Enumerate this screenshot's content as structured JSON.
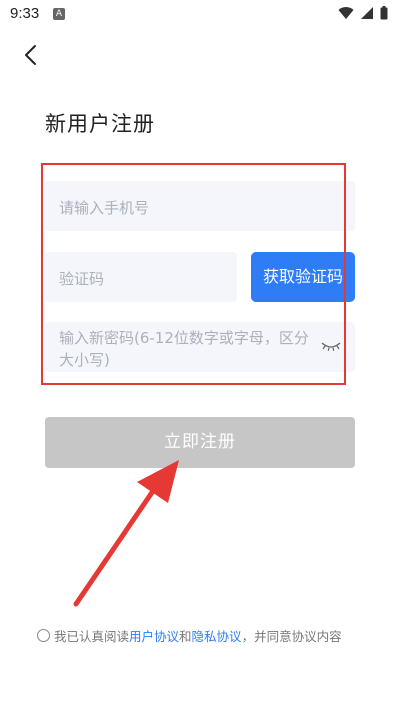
{
  "status_bar": {
    "time": "9:33",
    "notification_letter": "A"
  },
  "header": {
    "title": "新用户注册"
  },
  "form": {
    "phone_placeholder": "请输入手机号",
    "code_placeholder": "验证码",
    "get_code_label": "获取验证码",
    "password_placeholder": "输入新密码(6-12位数字或字母，区分大小写)"
  },
  "register_label": "立即注册",
  "agreement": {
    "prefix": "我已认真阅读",
    "user_agreement": "用户协议",
    "and": "和",
    "privacy_policy": "隐私协议",
    "suffix": "，并同意协议内容"
  },
  "colors": {
    "accent": "#2e7cf6",
    "annotation": "#e53935",
    "disabled_button": "#c6c6c6"
  },
  "icons": [
    "back-chevron-icon",
    "wifi-icon",
    "signal-icon",
    "battery-icon",
    "eye-closed-icon"
  ]
}
